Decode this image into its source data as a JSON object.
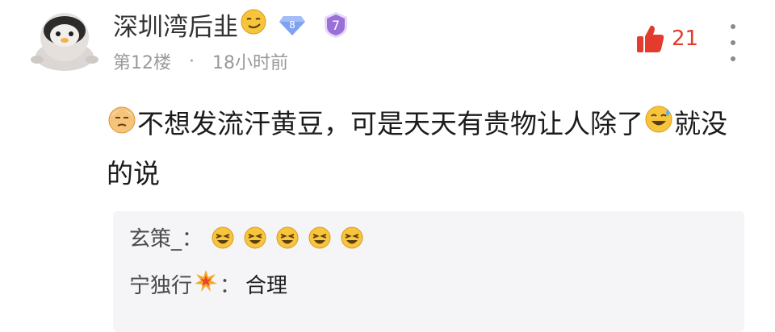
{
  "post": {
    "username": "深圳湾后韭",
    "level_badge": "8",
    "rank_badge": "7",
    "floor": "第12楼",
    "separator": "·",
    "time": "18小时前",
    "likes": "21",
    "icons": {
      "avatar": "penguin-avatar",
      "name_emoji": "smirk-emoji",
      "level": "diamond-badge-icon",
      "rank": "purple-shield-badge-icon",
      "like": "thumb-up-icon",
      "more": "more-vertical-icon"
    },
    "colors": {
      "like": "#e33b2e",
      "level_badge": "#7fa2f2",
      "rank_badge": "#9b6fd8"
    }
  },
  "comment": {
    "part1": "不想发流汗黄豆，可是天天有贵物让人除了",
    "part2": "就没的说",
    "icons": [
      "old-man-emoji",
      "sweat-smile-emoji"
    ]
  },
  "replies": [
    {
      "name": "玄策_",
      "colon": "：",
      "text": "",
      "emoji": "laughing-emoji",
      "emoji_count": 5
    },
    {
      "name": "宁独行",
      "colon": "：",
      "text": "合理",
      "emoji": "collision-emoji"
    },
    {
      "name": "",
      "colon": "",
      "text": "",
      "note": "partially cut off"
    }
  ]
}
